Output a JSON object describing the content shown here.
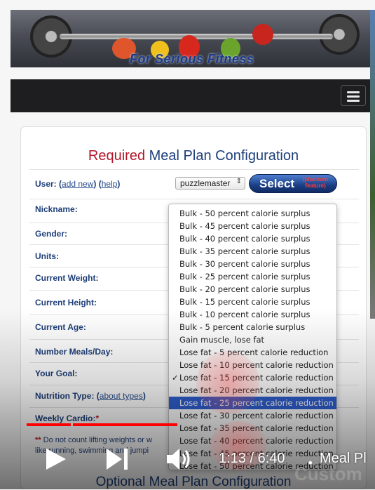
{
  "banner": {
    "tagline": "For Serious Fitness"
  },
  "form": {
    "title_required": "Required",
    "title_rest": " Meal Plan Configuration",
    "user_label": "User:",
    "add_new": "add new",
    "help": "help",
    "user_value": "puzzlemaster",
    "select_label": "Select",
    "select_badge": "(platinum feature)",
    "fields": [
      "Nickname:",
      "Gender:",
      "Units:",
      "Current Weight:",
      "Current Height:",
      "Current Age:",
      "Number Meals/Day:",
      "Your Goal:"
    ],
    "nutrition_label": "Nutrition Type:",
    "about_types": "about types",
    "weekly_cardio": "Weekly Cardio:",
    "note_prefix": "**",
    "note_text": " Do not count lifting weights or w",
    "note_text2": "like running, swimming and jumpi",
    "optional_title": "Optional Meal Plan Configuration"
  },
  "goal_dropdown": {
    "options": [
      "Bulk - 50 percent calorie surplus",
      "Bulk - 45 percent calorie surplus",
      "Bulk - 40 percent calorie surplus",
      "Bulk - 35 percent calorie surplus",
      "Bulk - 30 percent calorie surplus",
      "Bulk - 25 percent calorie surplus",
      "Bulk - 20 percent calorie surplus",
      "Bulk - 15 percent calorie surplus",
      "Bulk - 10 percent calorie surplus",
      "Bulk - 5 percent calorie surplus",
      "Gain muscle, lose fat",
      "Lose fat - 5 percent calorie reduction",
      "Lose fat - 10 percent calorie reduction",
      "Lose fat - 15 percent calorie reduction",
      "Lose fat - 20 percent calorie reduction",
      "Lose fat - 25 percent calorie reduction",
      "Lose fat - 30 percent calorie reduction",
      "Lose fat - 35 percent calorie reduction",
      "Lose fat - 40 percent calorie reduction",
      "Lose fat - 45 percent calorie reduction",
      "Lose fat - 50 percent calorie reduction"
    ],
    "checked": "✓",
    "checked_index": 13,
    "highlighted_index": 15
  },
  "video": {
    "time": "1:13 / 6:40",
    "separator": "•",
    "title": "Meal Pl",
    "watermark": "Custom",
    "progress_fraction": 0.183,
    "progress_color": "#ff0000"
  },
  "colors": {
    "navy": "#1f3f79",
    "required_red": "#b2192a",
    "highlight": "#2f5fd0"
  }
}
